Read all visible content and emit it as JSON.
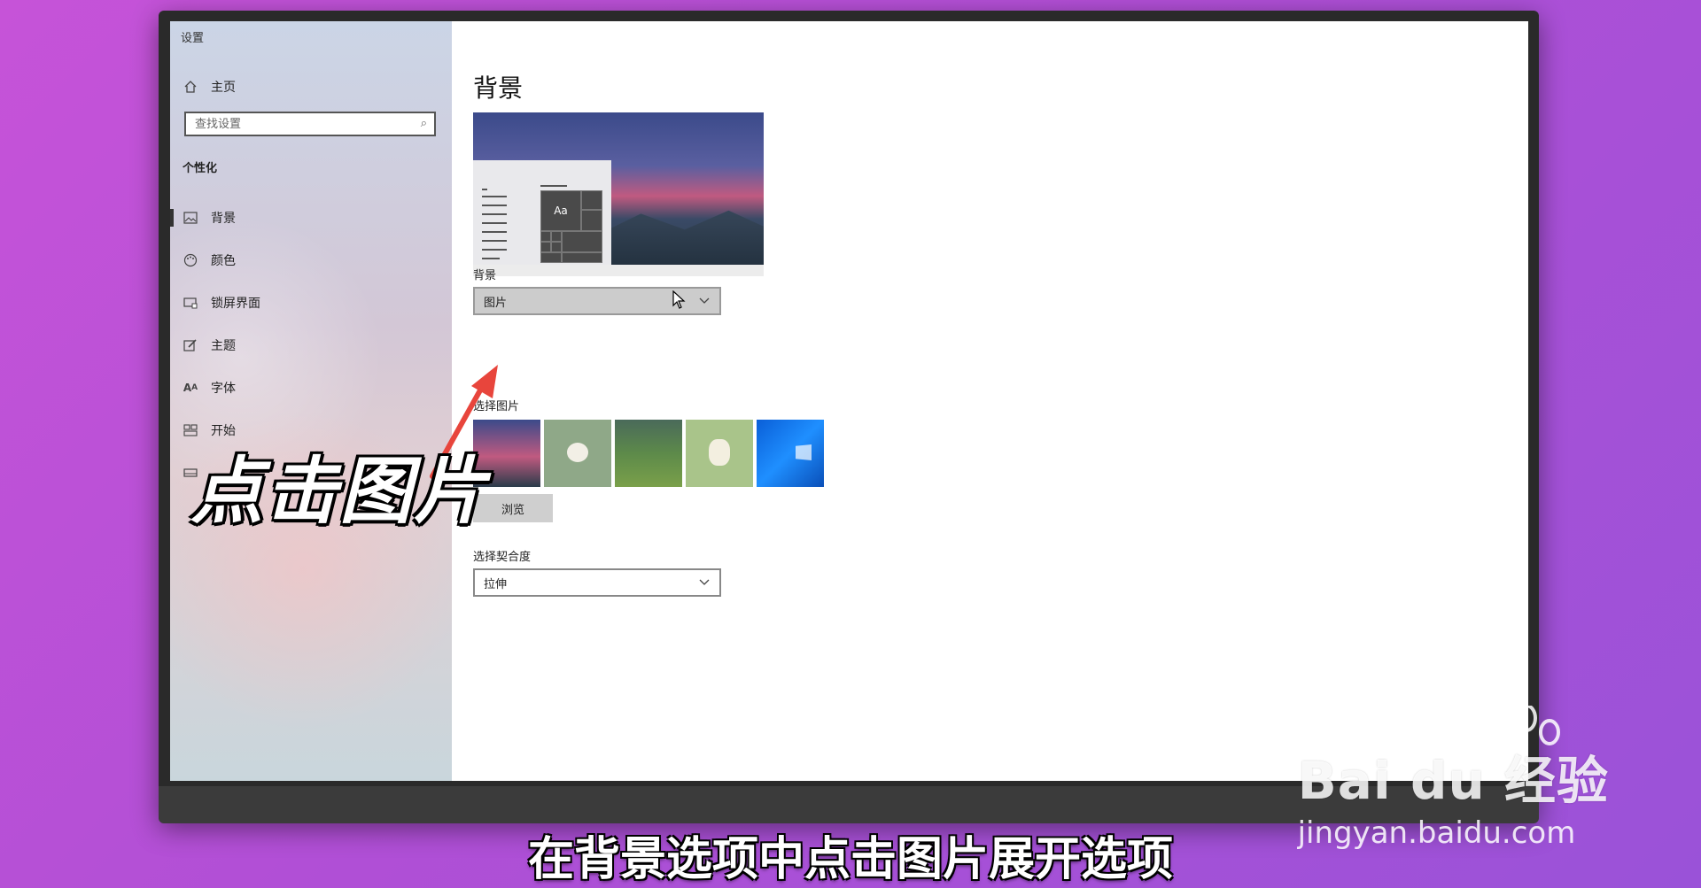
{
  "window": {
    "title": "设置"
  },
  "sidebar": {
    "home_label": "主页",
    "search_placeholder": "查找设置",
    "section_title": "个性化",
    "items": [
      {
        "label": "背景",
        "icon": "image-icon"
      },
      {
        "label": "颜色",
        "icon": "palette-icon"
      },
      {
        "label": "锁屏界面",
        "icon": "lock-screen-icon"
      },
      {
        "label": "主题",
        "icon": "brush-icon"
      },
      {
        "label": "字体",
        "icon": "font-icon"
      },
      {
        "label": "开始",
        "icon": "start-icon"
      }
    ]
  },
  "main": {
    "title": "背景",
    "preview_tile_text": "Aa",
    "background_label": "背景",
    "background_value": "图片",
    "choose_picture_label": "选择图片",
    "browse_label": "浏览",
    "fit_label": "选择契合度",
    "fit_value": "拉伸"
  },
  "overlay": {
    "callout": "点击图片",
    "subtitle": "在背景选项中点击图片展开选项"
  },
  "watermark": {
    "brand": "Bai du 经验",
    "url": "jingyan.baidu.com"
  }
}
